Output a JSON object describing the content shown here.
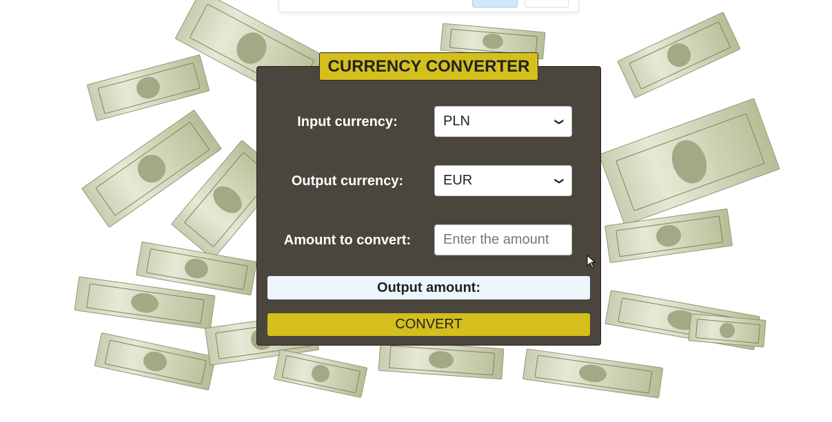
{
  "converter": {
    "title": "CURRENCY CONVERTER",
    "input_currency_label": "Input currency:",
    "input_currency_value": "PLN",
    "output_currency_label": "Output currency:",
    "output_currency_value": "EUR",
    "amount_label": "Amount to convert:",
    "amount_placeholder": "Enter the amount",
    "output_amount_label": "Output amount:",
    "convert_button": "CONVERT"
  },
  "colors": {
    "card_bg": "#4a463d",
    "accent_yellow": "#d4bf1c",
    "output_bg": "#eef5fc"
  },
  "icons": {
    "select_chevron": "chevron-down-icon",
    "pointer": "mouse-cursor-icon"
  }
}
